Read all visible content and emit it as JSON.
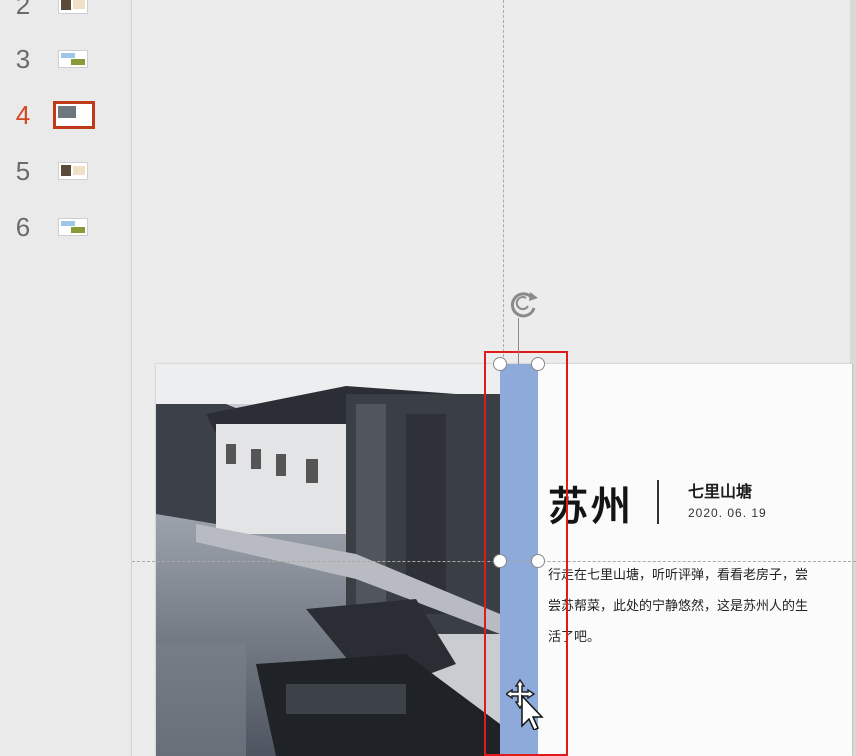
{
  "thumbnails": [
    {
      "number": "2",
      "style": "brown"
    },
    {
      "number": "3",
      "style": "landscape"
    },
    {
      "number": "4",
      "style": "gray",
      "active": true
    },
    {
      "number": "5",
      "style": "brown"
    },
    {
      "number": "6",
      "style": "landscape"
    }
  ],
  "slide": {
    "title": "苏州",
    "subtitle": "七里山塘",
    "date": "2020. 06. 19",
    "body": "行走在七里山塘，听听评弹，看看老房子，尝尝苏帮菜，此处的宁静悠然，这是苏州人的生活了吧。"
  },
  "colors": {
    "selected_shape_fill": "#8eaadb",
    "highlight_box": "#e01b1b",
    "active_thumbnail_accent": "#c0391b",
    "active_number": "#d24726"
  },
  "icons": [
    "rotate-icon",
    "move-cursor-icon"
  ]
}
